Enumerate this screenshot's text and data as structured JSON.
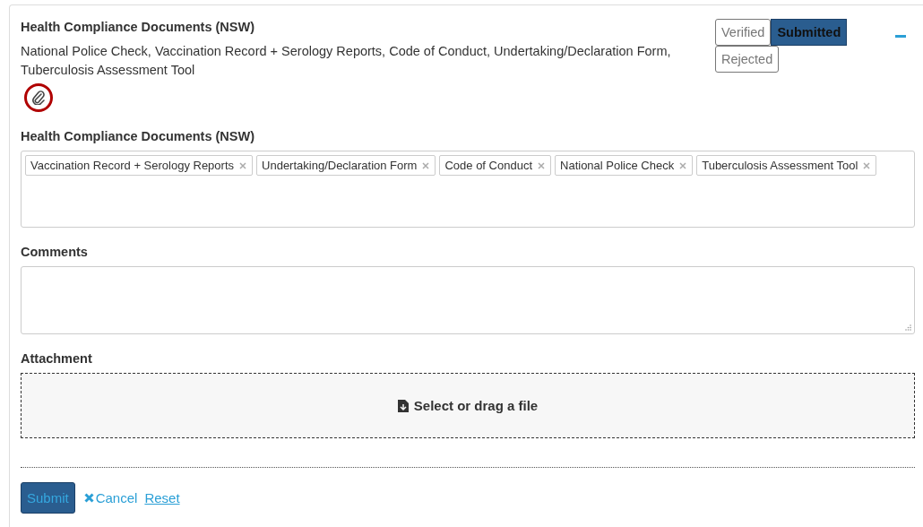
{
  "section": {
    "title": "Health Compliance Documents (NSW)",
    "summary": "National Police Check, Vaccination Record + Serology Reports, Code of Conduct, Undertaking/Declaration Form, Tuberculosis Assessment Tool",
    "attachment_highlighted": true,
    "expanded": true
  },
  "statuses": [
    {
      "label": "Verified",
      "selected": false
    },
    {
      "label": "Submitted",
      "selected": true
    },
    {
      "label": "Rejected",
      "selected": false
    }
  ],
  "documents_field": {
    "label": "Health Compliance Documents (NSW)",
    "tags": [
      {
        "label": "Vaccination Record + Serology Reports"
      },
      {
        "label": "Undertaking/Declaration Form"
      },
      {
        "label": "Code of Conduct"
      },
      {
        "label": "National Police Check"
      },
      {
        "label": "Tuberculosis Assessment Tool"
      }
    ]
  },
  "comments": {
    "label": "Comments"
  },
  "attachment": {
    "label": "Attachment",
    "dropzone": "Select or drag a file"
  },
  "actions": {
    "submit": "Submit",
    "cancel": "Cancel",
    "reset": "Reset"
  }
}
